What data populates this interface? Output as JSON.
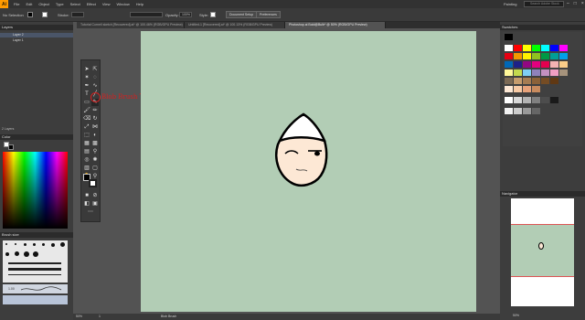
{
  "menubar": {
    "logo": "Ai",
    "items": [
      "File",
      "Edit",
      "Object",
      "Type",
      "Select",
      "Effect",
      "View",
      "Window",
      "Help"
    ],
    "workspace": "Painting",
    "search_placeholder": "Search Adobe Stock"
  },
  "controlbar": {
    "selection": "No Selection",
    "stroke_label": "Stroke:",
    "opacity_label": "Opacity:",
    "opacity_value": "100%",
    "style_label": "Style:",
    "document_setup": "Document Setup",
    "preferences": "Preferences"
  },
  "tabs": [
    {
      "label": "Tutorial Cornell sketch [Recovered].ai* @ 100.46% (RGB/GPU Preview)",
      "active": false
    },
    {
      "label": "Untitled-1 [Recovered].ai* @ 100.13% (RGB/GPU Preview)",
      "active": false
    },
    {
      "label": "Photoshop.ai Bold@Bulb* @ 50% (RGB/GPU Preview)",
      "active": true
    }
  ],
  "layers": {
    "title": "Layers",
    "items": [
      "Layer 2",
      "Layer 1"
    ],
    "count": "2 Layers"
  },
  "color_panel": {
    "title": "Color"
  },
  "brushes_panel": {
    "title": "Brush size",
    "value": "1.00"
  },
  "annotation": "Blob Brush Tool",
  "status": {
    "zoom": "50%",
    "page": "1",
    "tool": "Blob Brush"
  },
  "swatches": {
    "title": "Swatches"
  },
  "navigator": {
    "title": "Navigator",
    "zoom": "50%"
  },
  "colors": {
    "canvas": "#b2cdb5",
    "annotation": "#d42020",
    "face_fill": "#fde8d5",
    "cap_fill": "#ffffff"
  }
}
